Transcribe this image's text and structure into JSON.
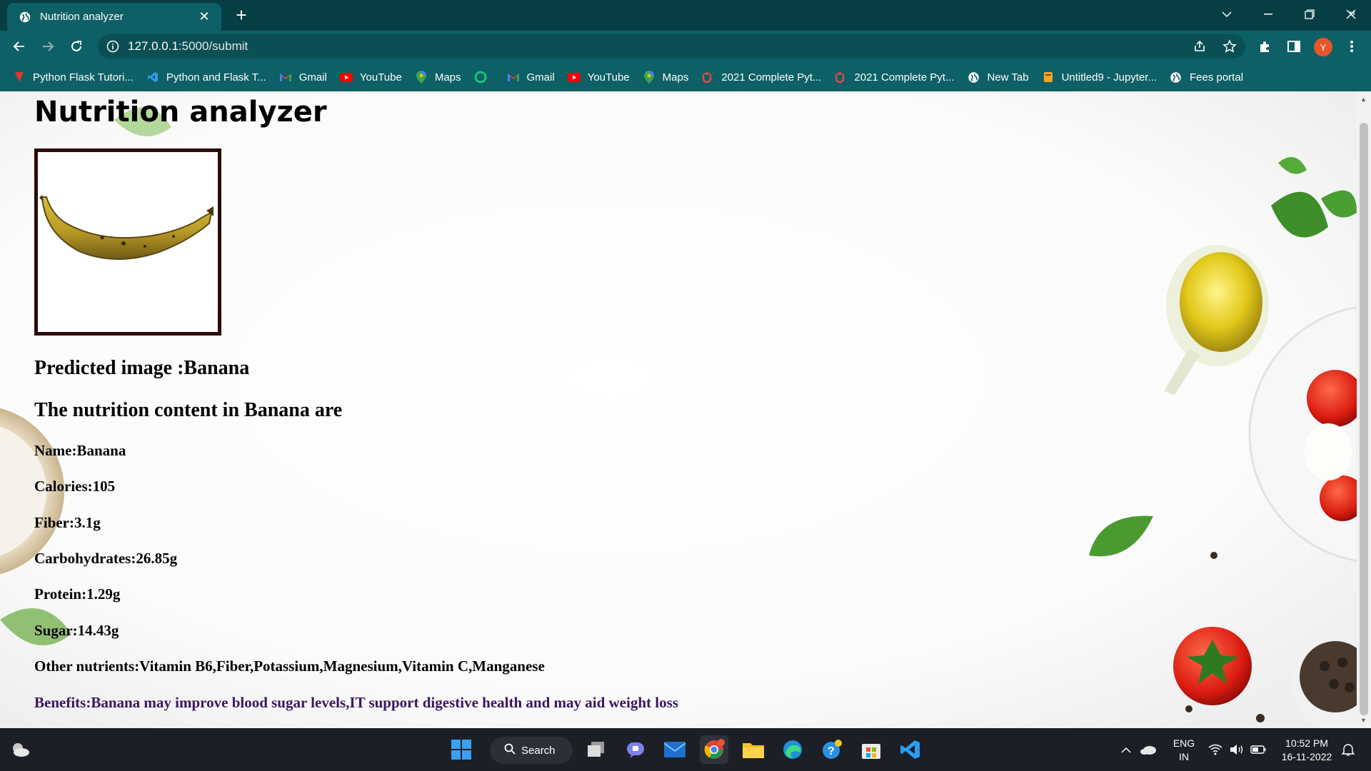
{
  "browser": {
    "tab_title": "Nutrition analyzer",
    "url_host": "127.0.0.1",
    "url_path": ":5000/submit",
    "profile_initial": "Y",
    "bookmarks": [
      {
        "label": "Python Flask Tutori...",
        "icon": "flask-tutorial-icon"
      },
      {
        "label": "Python and Flask T...",
        "icon": "vscode-icon"
      },
      {
        "label": "Gmail",
        "icon": "gmail-icon"
      },
      {
        "label": "YouTube",
        "icon": "youtube-icon"
      },
      {
        "label": "Maps",
        "icon": "maps-icon"
      },
      {
        "label": "",
        "icon": "green-circle-icon"
      },
      {
        "label": "Gmail",
        "icon": "gmail-icon"
      },
      {
        "label": "YouTube",
        "icon": "youtube-icon"
      },
      {
        "label": "Maps",
        "icon": "maps-icon"
      },
      {
        "label": "2021 Complete Pyt...",
        "icon": "udemy-icon"
      },
      {
        "label": "2021 Complete Pyt...",
        "icon": "udemy-icon"
      },
      {
        "label": "New Tab",
        "icon": "globe-icon"
      },
      {
        "label": "Untitled9 - Jupyter...",
        "icon": "jupyter-icon"
      },
      {
        "label": "Fees portal",
        "icon": "globe-icon"
      }
    ],
    "colors": {
      "tab_bar": "#063e44",
      "toolbar": "#0d6065"
    }
  },
  "page": {
    "title": "Nutrition analyzer",
    "predicted": "Predicted image :Banana",
    "nutrition_heading": "The nutrition content in Banana are",
    "name": "Name:Banana",
    "calories": "Calories:105",
    "fiber": "Fiber:3.1g",
    "carbohydrates": "Carbohydrates:26.85g",
    "protein": "Protein:1.29g",
    "sugar": "Sugar:14.43g",
    "other_nutrients": "Other nutrients:Vitamin B6,Fiber,Potassium,Magnesium,Vitamin C,Manganese",
    "benefits": "Benefits:Banana may improve blood sugar levels,IT support digestive health and may aid weight loss",
    "benefits_color": "#3a1660"
  },
  "taskbar": {
    "search_label": "Search",
    "language": "ENG",
    "region": "IN",
    "time": "10:52 PM",
    "date": "16-11-2022"
  }
}
